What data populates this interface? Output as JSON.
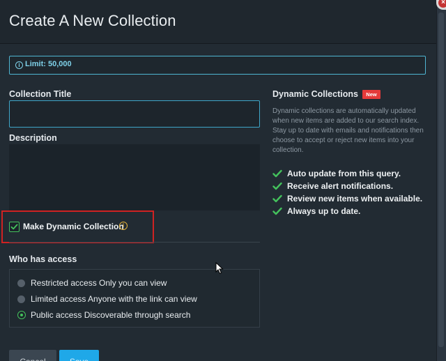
{
  "modal": {
    "title": "Create A New Collection",
    "limit": "Limit: 50,000"
  },
  "form": {
    "collection_title_label": "Collection Title",
    "collection_title_value": "",
    "description_label": "Description",
    "description_value": "",
    "dynamic_checkbox_label": "Make Dynamic Collection",
    "dynamic_checked": true
  },
  "access": {
    "heading": "Who has access",
    "options": [
      {
        "label": "Restricted access Only you can view",
        "selected": false
      },
      {
        "label": "Limited access Anyone with the link can view",
        "selected": false
      },
      {
        "label": "Public access Discoverable through search",
        "selected": true
      }
    ]
  },
  "buttons": {
    "cancel": "Cancel",
    "save": "Save"
  },
  "dynamic_panel": {
    "title": "Dynamic Collections",
    "badge": "New",
    "description": "Dynamic collections are automatically updated when new items are added to our search index. Stay up to date with emails and notifications then choose to accept or reject new items into your collection.",
    "features": [
      "Auto update from this query.",
      "Receive alert notifications.",
      "Review new items when available.",
      "Always up to date."
    ]
  },
  "colors": {
    "accent": "#1fa8e8",
    "success": "#44c25c",
    "badge": "#e53a3a",
    "highlight": "#d02222"
  }
}
